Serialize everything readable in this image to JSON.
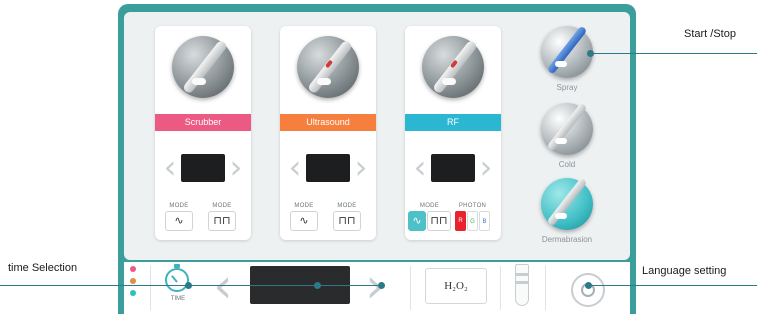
{
  "cards": [
    {
      "label": "Scrubber",
      "modes": [
        "MODE",
        "MODE"
      ],
      "photon": null
    },
    {
      "label": "Ultrasound",
      "modes": [
        "MODE",
        "MODE"
      ],
      "photon": null
    },
    {
      "label": "RF",
      "modes": [
        "MODE"
      ],
      "photon": {
        "label": "PHOTON",
        "options": [
          "R",
          "G",
          "B"
        ]
      }
    }
  ],
  "side_buttons": [
    "Spray",
    "Cold",
    "Dermabrasion"
  ],
  "bottom": {
    "time_caption": "TIME",
    "h2o2": "H₂O₂"
  },
  "callouts": {
    "start_stop": "Start /Stop",
    "time_selection": "time  Selection",
    "language": "Language setting"
  },
  "icons": {
    "prev": "chevron-left-icon",
    "next": "chevron-right-icon",
    "timer": "stopwatch-icon",
    "tube": "test-tube-icon",
    "language": "language-icon",
    "wave": "sine-wave-icon",
    "pulse": "square-pulse-icon"
  },
  "colors": {
    "frame": "#3c9e9c",
    "scrubber": "#ec5a83",
    "ultrasound": "#f77f3e",
    "rf": "#2bb6d2",
    "accent": "#4dc0c8",
    "callout": "#2c7a88"
  },
  "status_dots": [
    "#ec5a83",
    "#e68c3e",
    "#2cc2b6"
  ]
}
